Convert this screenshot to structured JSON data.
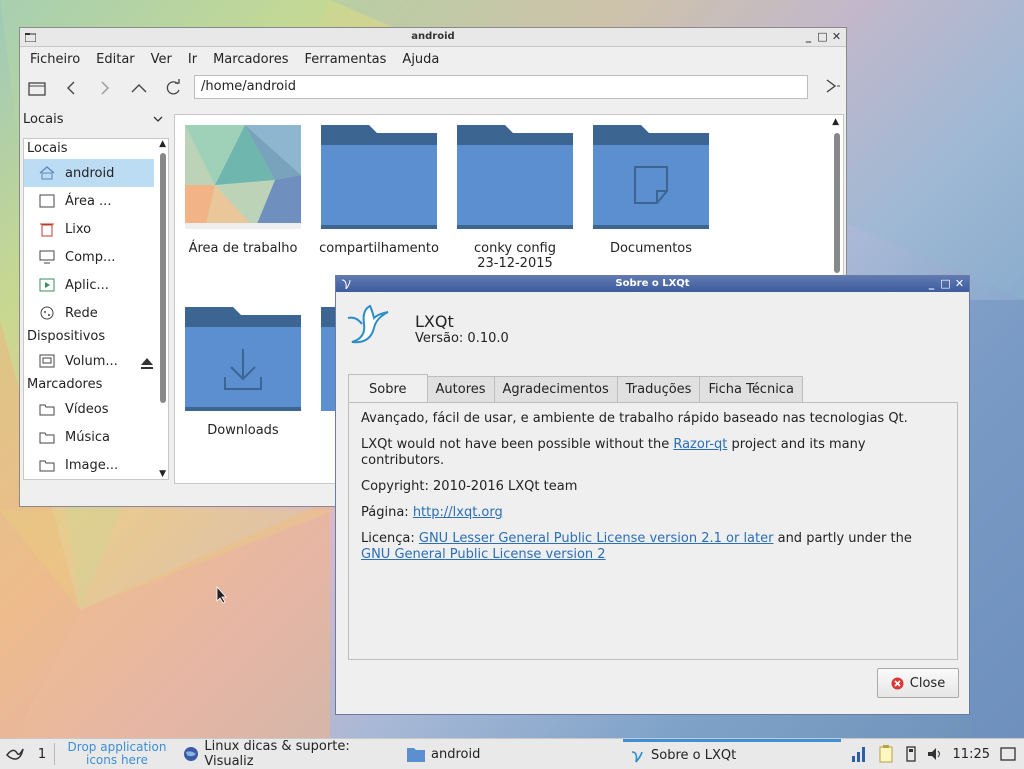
{
  "fm": {
    "title": "android",
    "menu": [
      "Ficheiro",
      "Editar",
      "Ver",
      "Ir",
      "Marcadores",
      "Ferramentas",
      "Ajuda"
    ],
    "path": "/home/android",
    "side_header": "Locais",
    "places_section": "Locais",
    "places": [
      "android",
      "Área ...",
      "Lixo",
      "Comp...",
      "Aplic...",
      "Rede"
    ],
    "devices_section": "Dispositivos",
    "devices": [
      "Volum..."
    ],
    "bookmarks_section": "Marcadores",
    "bookmarks": [
      "Vídeos",
      "Música",
      "Image..."
    ],
    "files": [
      {
        "name": "Área de trabalho",
        "type": "desktop-thumbnail"
      },
      {
        "name": "compartilhamento",
        "type": "folder"
      },
      {
        "name": "conky config 23-12-2015",
        "type": "folder"
      },
      {
        "name": "Documentos",
        "type": "folder-documents"
      },
      {
        "name": "Downloads",
        "type": "folder-downloads"
      }
    ]
  },
  "about": {
    "title": "Sobre o LXQt",
    "app_name": "LXQt",
    "version": "Versão: 0.10.0",
    "tabs": [
      "Sobre",
      "Autores",
      "Agradecimentos",
      "Traduções",
      "Ficha Técnica"
    ],
    "p1": "Avançado, fácil de usar, e ambiente de trabalho rápido baseado nas tecnologias Qt.",
    "p2_pre": "LXQt would not have been possible without the ",
    "p2_link": "Razor-qt",
    "p2_post": " project and its many contributors.",
    "p3": "Copyright: 2010-2016 LXQt team",
    "p4_label": "Página: ",
    "p4_link": "http://lxqt.org",
    "p5_label": "Licença: ",
    "p5_link1": "GNU Lesser General Public License version 2.1 or later",
    "p5_mid": " and partly under the",
    "p5_link2": "GNU General Public License version 2",
    "close_label": "Close"
  },
  "taskbar": {
    "desktop_num": "1",
    "drop_hint": "Drop application icons here",
    "tasks": [
      {
        "label": "Linux dicas & suporte: Visualiz",
        "icon": "browser-icon"
      },
      {
        "label": "android",
        "icon": "folder-icon"
      },
      {
        "label": "Sobre o LXQt",
        "icon": "lxqt-icon"
      }
    ],
    "clock": "11:25"
  },
  "colors": {
    "accent": "#3d8fd6",
    "folder": "#5b8fcf",
    "folder_dark": "#3c6591",
    "link": "#2a6fb7",
    "title_active": "#4a69a8"
  }
}
